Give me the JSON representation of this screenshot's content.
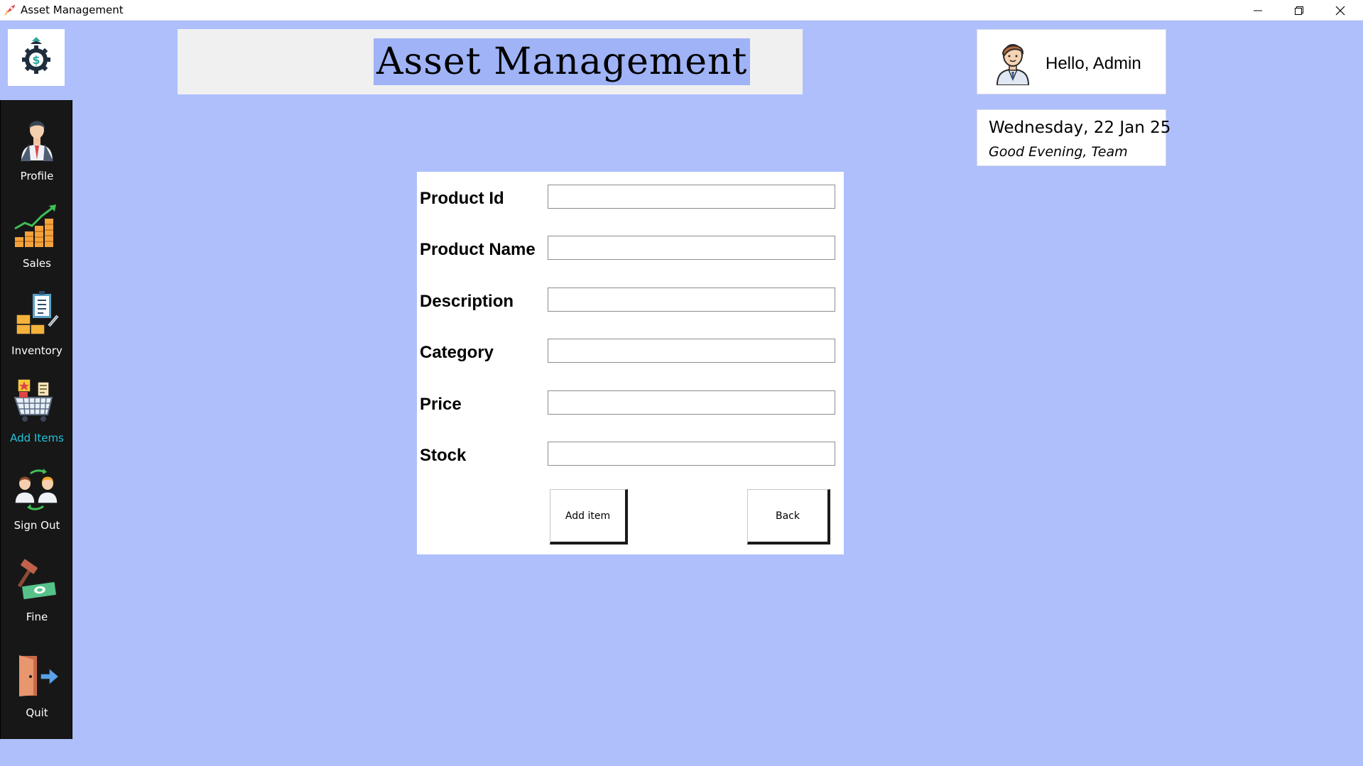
{
  "window": {
    "title": "Asset Management",
    "minimize_icon": "minimize-icon",
    "restore_icon": "restore-icon",
    "close_icon": "close-icon"
  },
  "header": {
    "title": "Asset Management"
  },
  "greeting": {
    "text": "Hello, Admin",
    "avatar_icon": "admin-avatar-icon"
  },
  "date_panel": {
    "date": "Wednesday, 22 Jan 25",
    "message": "Good Evening, Team"
  },
  "sidebar": {
    "active_color": "#23c4d8",
    "items": [
      {
        "label": "Profile",
        "icon": "profile-icon"
      },
      {
        "label": "Sales",
        "icon": "sales-chart-icon"
      },
      {
        "label": "Inventory",
        "icon": "inventory-icon"
      },
      {
        "label": "Add Items",
        "icon": "add-items-cart-icon",
        "active": true
      },
      {
        "label": "Sign Out",
        "icon": "sign-out-users-icon"
      },
      {
        "label": "Fine",
        "icon": "fine-gavel-icon"
      },
      {
        "label": "Quit",
        "icon": "quit-door-icon"
      }
    ]
  },
  "form": {
    "fields": [
      {
        "label": "Product Id",
        "value": ""
      },
      {
        "label": "Product Name",
        "value": ""
      },
      {
        "label": "Description",
        "value": ""
      },
      {
        "label": "Category",
        "value": ""
      },
      {
        "label": "Price",
        "value": ""
      },
      {
        "label": "Stock",
        "value": ""
      }
    ],
    "add_button": "Add item",
    "back_button": "Back"
  },
  "colors": {
    "background": "#aebffc",
    "sidebar": "#171717",
    "title_highlight": "#9fb3f6"
  }
}
